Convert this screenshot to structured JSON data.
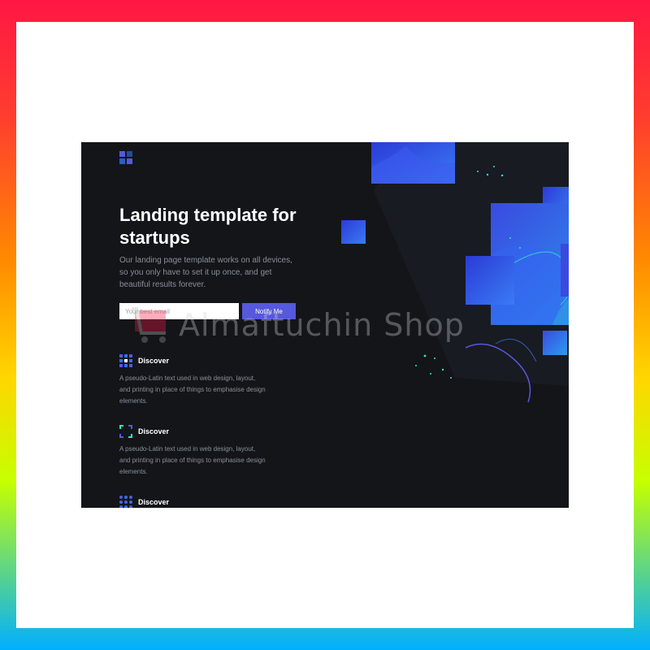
{
  "colors": {
    "page_background": "#131519",
    "accent": "#5658dd",
    "card_gradient": [
      "#2b3bd6",
      "#2f6ff0"
    ],
    "teal": "#2ee6c7",
    "muted_text": "#8a8f9b"
  },
  "logo": {
    "icon": "logo-mark-icon"
  },
  "hero": {
    "title": "Landing template for startups",
    "description": "Our landing page template works on all devices, so you only have to set it up once, and get beautiful results forever."
  },
  "signup": {
    "email_placeholder": "Your best email",
    "email_value": "",
    "button_label": "Notify Me"
  },
  "features": [
    {
      "icon": "grid-dots-icon",
      "title": "Discover",
      "text": "A pseudo-Latin text used in web design, layout, and printing in place of things to emphasise design elements."
    },
    {
      "icon": "focus-frame-icon",
      "title": "Discover",
      "text": "A pseudo-Latin text used in web design, layout, and printing in place of things to emphasise design elements."
    },
    {
      "icon": "grid-dots-icon",
      "title": "Discover",
      "text": ""
    }
  ],
  "watermark": {
    "text": "Almaftuchin Shop"
  }
}
